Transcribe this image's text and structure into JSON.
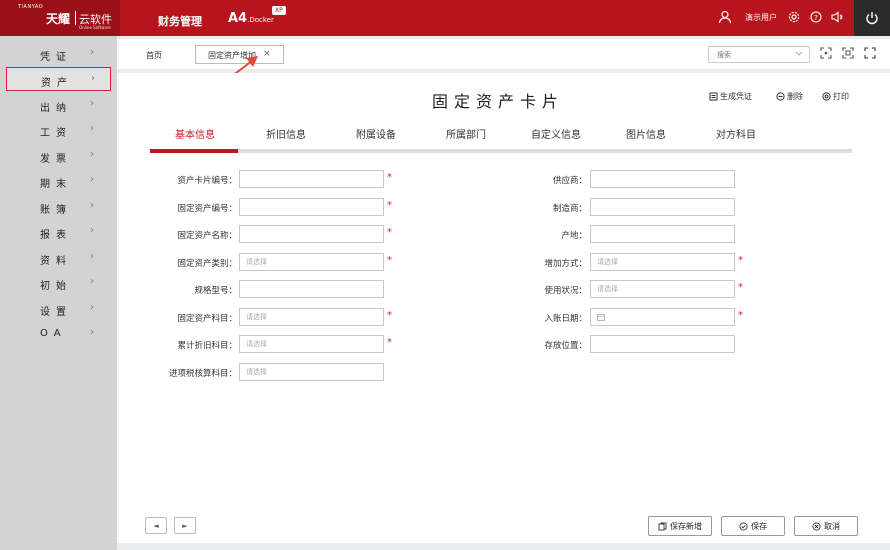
{
  "header": {
    "logo_small": "TIANYAO",
    "logo_brand": "天耀",
    "logo_cloud": "云软件",
    "logo_sub": "Online Software",
    "system_name": "财务管理",
    "product": "A4",
    "product_suffix": ".Docker",
    "badge": "XP",
    "username": "演示用户"
  },
  "sidebar": {
    "items": [
      {
        "label": "凭证"
      },
      {
        "label": "资产"
      },
      {
        "label": "出纳"
      },
      {
        "label": "工资"
      },
      {
        "label": "发票"
      },
      {
        "label": "期末"
      },
      {
        "label": "账簿"
      },
      {
        "label": "报表"
      },
      {
        "label": "资料"
      },
      {
        "label": "初始"
      },
      {
        "label": "设置"
      },
      {
        "label": "OA"
      }
    ],
    "arrow": "›"
  },
  "tabs": {
    "home": "首页",
    "open_tab": "固定资产增加",
    "close": "×",
    "search_placeholder": "搜索"
  },
  "card": {
    "title": "固定资产卡片",
    "actions": {
      "voucher": "生成凭证",
      "delete": "删除",
      "print": "打印"
    },
    "subtabs": [
      "基本信息",
      "折旧信息",
      "附属设备",
      "所属部门",
      "自定义信息",
      "图片信息",
      "对方科目"
    ]
  },
  "form": {
    "left": [
      {
        "label": "资产卡片编号：",
        "placeholder": "",
        "required": "*"
      },
      {
        "label": "固定资产编号：",
        "placeholder": "",
        "required": "*"
      },
      {
        "label": "固定资产名称：",
        "placeholder": "",
        "required": "*"
      },
      {
        "label": "固定资产类别：",
        "placeholder": "请选择",
        "required": "*"
      },
      {
        "label": "规格型号：",
        "placeholder": "",
        "required": ""
      },
      {
        "label": "固定资产科目：",
        "placeholder": "请选择",
        "required": "*"
      },
      {
        "label": "累计折旧科目：",
        "placeholder": "请选择",
        "required": "*"
      },
      {
        "label": "进项税核算科目：",
        "placeholder": "请选择",
        "required": ""
      }
    ],
    "right": [
      {
        "label": "供应商：",
        "placeholder": "",
        "required": ""
      },
      {
        "label": "制造商：",
        "placeholder": "",
        "required": ""
      },
      {
        "label": "产地：",
        "placeholder": "",
        "required": ""
      },
      {
        "label": "增加方式：",
        "placeholder": "请选择",
        "required": "*"
      },
      {
        "label": "使用状况：",
        "placeholder": "请选择",
        "required": "*"
      },
      {
        "label": "入账日期：",
        "placeholder": "",
        "required": "*"
      },
      {
        "label": "存放位置：",
        "placeholder": "",
        "required": ""
      }
    ]
  },
  "footer": {
    "prev": "◄",
    "next": "►",
    "save_new": "保存新增",
    "save": "保存",
    "cancel": "取消"
  },
  "colors": {
    "header_red": "#b8141e",
    "accent_red": "#c0151e",
    "sidebar_bg": "#d3d3d3"
  }
}
